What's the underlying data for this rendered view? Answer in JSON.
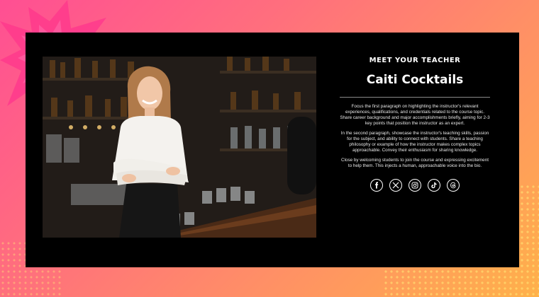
{
  "background": {
    "gradient_start": "#ff4f93",
    "gradient_end": "#ffb14a",
    "dot_color": "#ffeb78"
  },
  "card": {
    "background": "#000000"
  },
  "photo": {
    "subject": "smiling bartender with crossed arms in front of a bar with glassware"
  },
  "teacher": {
    "eyebrow": "MEET YOUR TEACHER",
    "name": "Caiti Cocktails",
    "paragraphs": [
      "Focus the first paragraph on highlighting the instructor's relevant experiences, qualifications, and credentials related to the course topic. Share career background and major accomplishments briefly, aiming for 2-3 key points that position the instructor as an expert.",
      "In the second paragraph, showcase the instructor's teaching skills, passion for the subject, and ability to connect with students. Share a teaching philosophy or example of how the instructor makes complex topics approachable. Convey their enthusiasm for sharing knowledge.",
      "Close by welcoming students to join the course and expressing excitement to help them. This injects a human, approachable voice into the bio."
    ]
  },
  "socials": [
    {
      "icon": "facebook-icon"
    },
    {
      "icon": "x-icon"
    },
    {
      "icon": "instagram-icon"
    },
    {
      "icon": "tiktok-icon"
    },
    {
      "icon": "threads-icon"
    }
  ]
}
